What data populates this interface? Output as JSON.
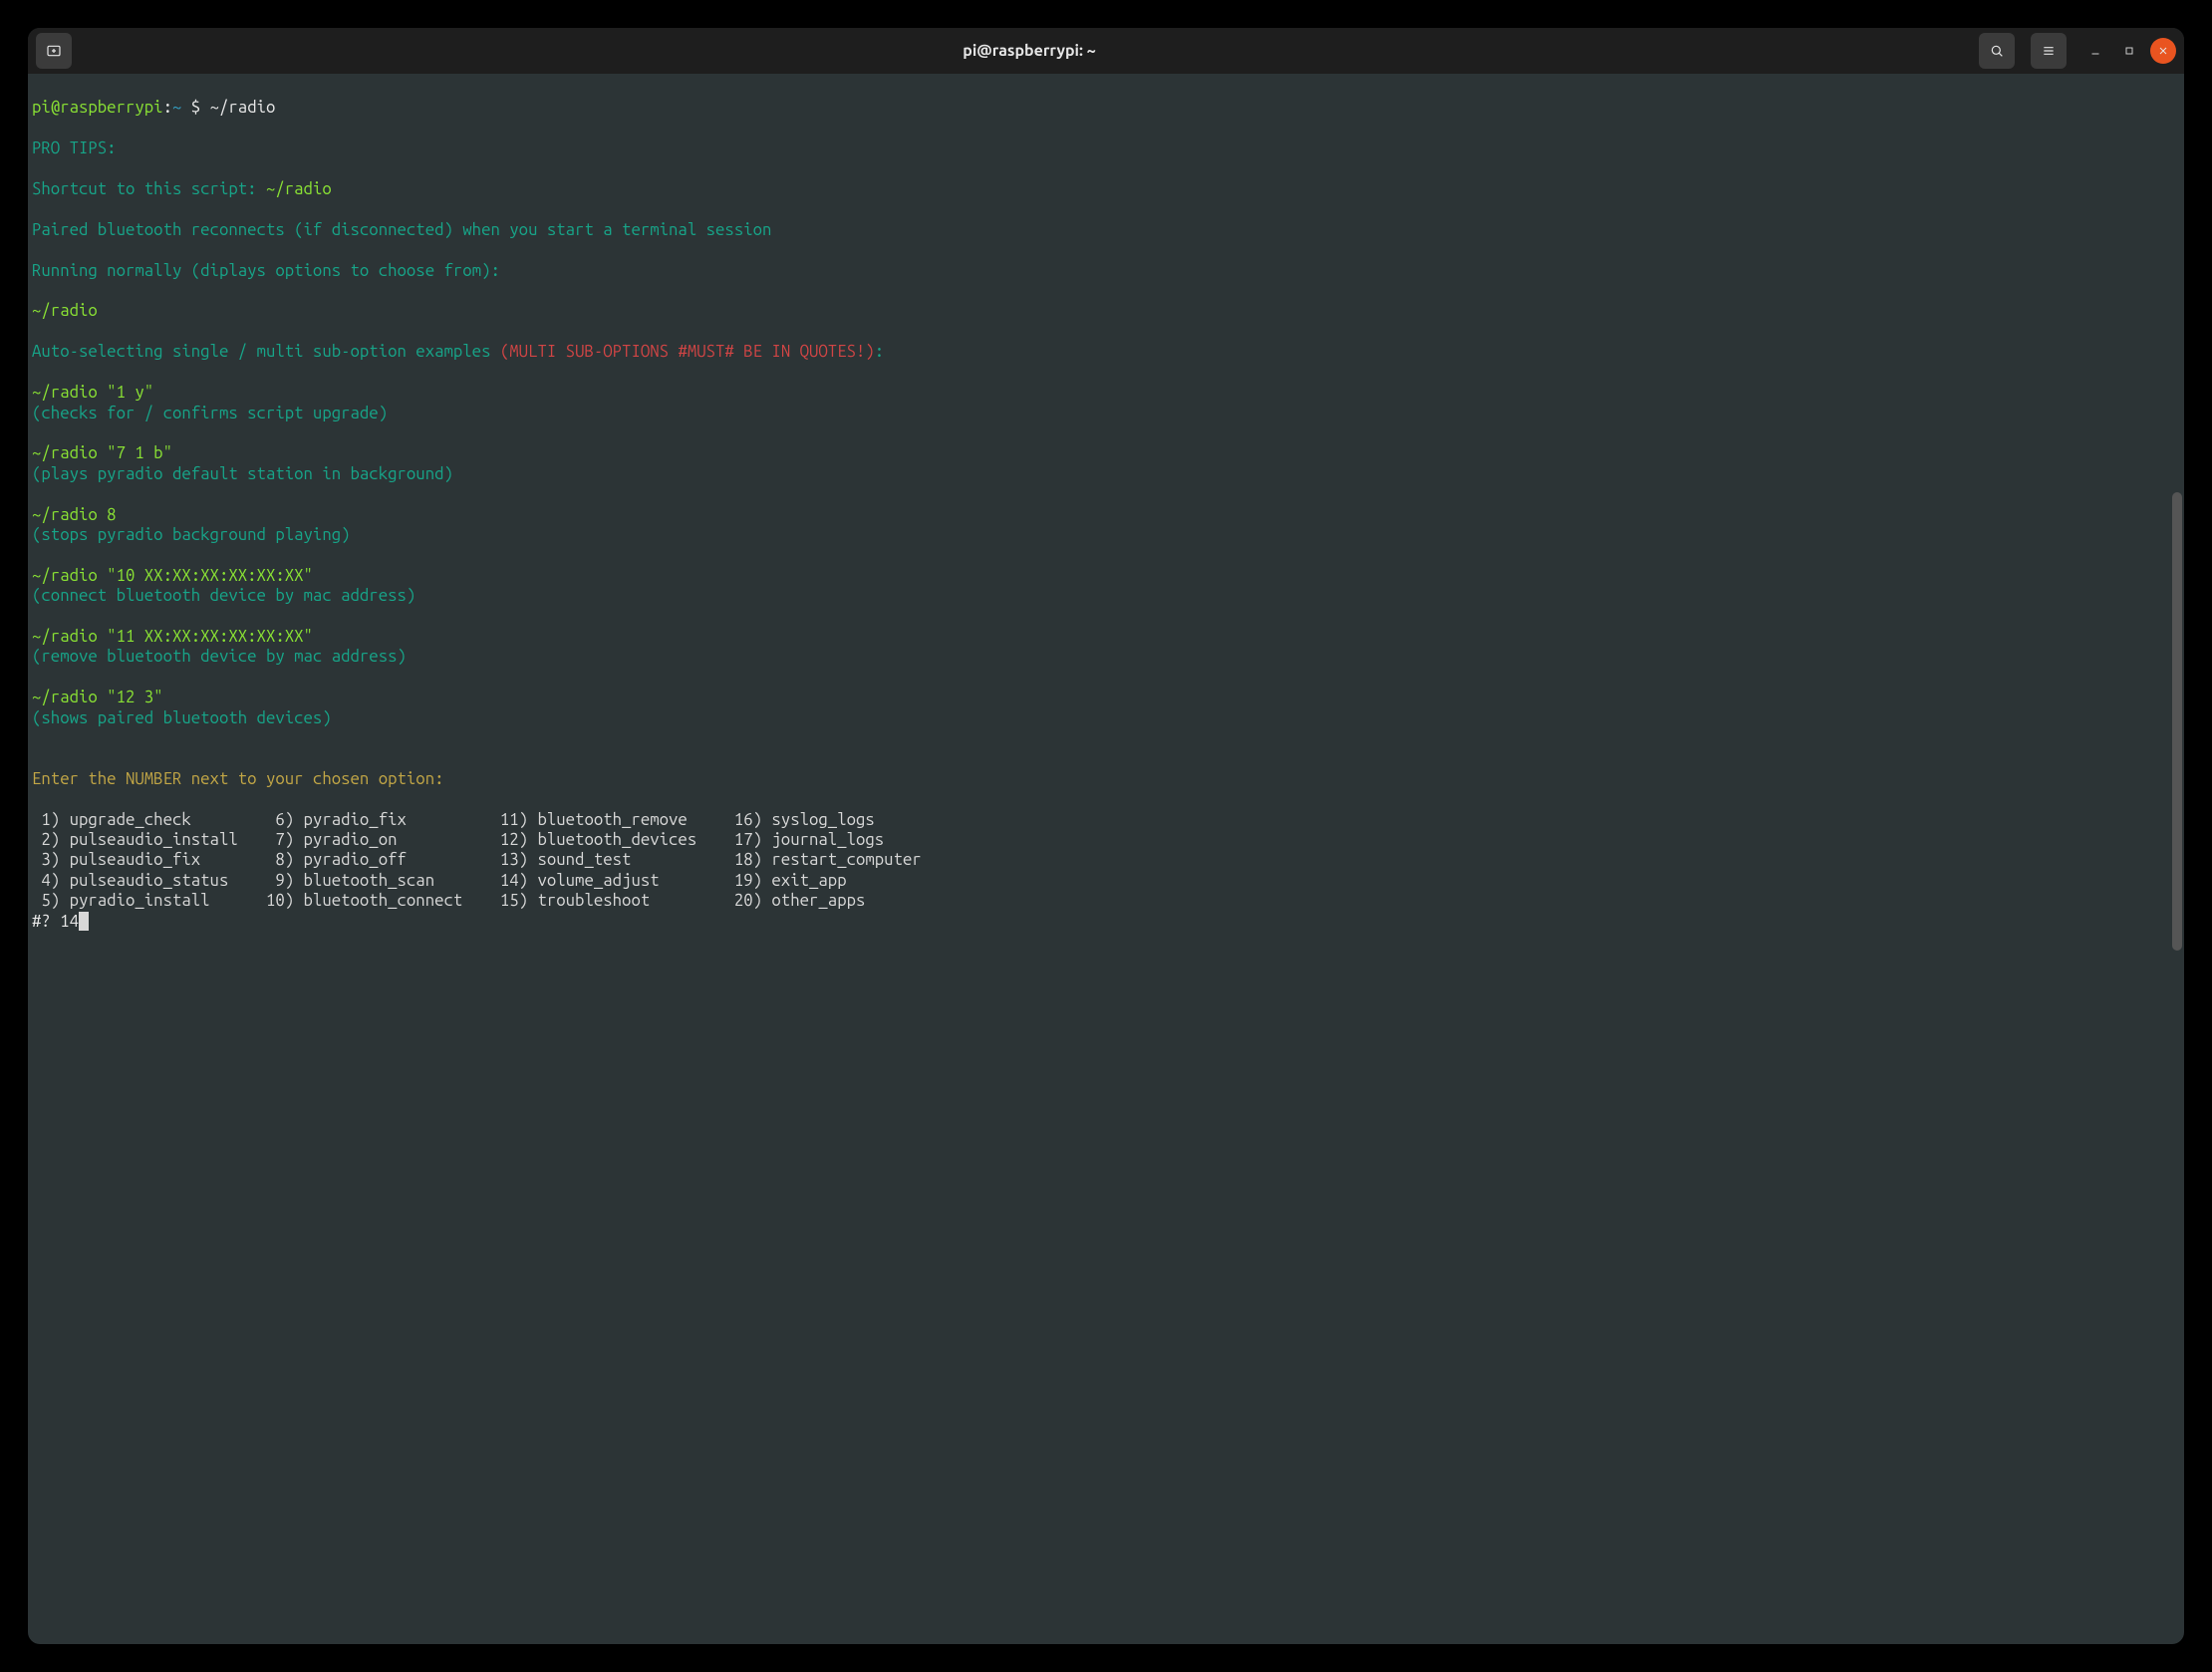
{
  "window": {
    "title": "pi@raspberrypi: ~"
  },
  "prompt": {
    "userhost": "pi@raspberrypi",
    "colon": ":",
    "path": "~",
    "dollar": "$",
    "cmd": "~/radio"
  },
  "tips": {
    "heading": "PRO TIPS:",
    "shortcut_label": "Shortcut to this script: ",
    "shortcut_cmd": "~/radio",
    "bt_reconnect": "Paired bluetooth reconnects (if disconnected) when you start a terminal session",
    "run_normal": "Running normally (diplays options to choose from):",
    "run_normal_cmd": "~/radio",
    "auto_label": "Auto-selecting single / multi sub-option examples ",
    "auto_warn": "(MULTI SUB-OPTIONS #MUST# BE IN QUOTES!)",
    "auto_colon": ":",
    "ex1_cmd": "~/radio \"1 y\"",
    "ex1_desc": "(checks for / confirms script upgrade)",
    "ex2_cmd": "~/radio \"7 1 b\"",
    "ex2_desc": "(plays pyradio default station in background)",
    "ex3_cmd": "~/radio 8",
    "ex3_desc": "(stops pyradio background playing)",
    "ex4_cmd": "~/radio \"10 XX:XX:XX:XX:XX:XX\"",
    "ex4_desc": "(connect bluetooth device by mac address)",
    "ex5_cmd": "~/radio \"11 XX:XX:XX:XX:XX:XX\"",
    "ex5_desc": "(remove bluetooth device by mac address)",
    "ex6_cmd": "~/radio \"12 3\"",
    "ex6_desc": "(shows paired bluetooth devices)"
  },
  "menu": {
    "prompt": "Enter the NUMBER next to your chosen option:",
    "items": [
      {
        "n": "1)",
        "l": "upgrade_check"
      },
      {
        "n": "2)",
        "l": "pulseaudio_install"
      },
      {
        "n": "3)",
        "l": "pulseaudio_fix"
      },
      {
        "n": "4)",
        "l": "pulseaudio_status"
      },
      {
        "n": "5)",
        "l": "pyradio_install"
      },
      {
        "n": "6)",
        "l": "pyradio_fix"
      },
      {
        "n": "7)",
        "l": "pyradio_on"
      },
      {
        "n": "8)",
        "l": "pyradio_off"
      },
      {
        "n": "9)",
        "l": "bluetooth_scan"
      },
      {
        "n": "10)",
        "l": "bluetooth_connect"
      },
      {
        "n": "11)",
        "l": "bluetooth_remove"
      },
      {
        "n": "12)",
        "l": "bluetooth_devices"
      },
      {
        "n": "13)",
        "l": "sound_test"
      },
      {
        "n": "14)",
        "l": "volume_adjust"
      },
      {
        "n": "15)",
        "l": "troubleshoot"
      },
      {
        "n": "16)",
        "l": "syslog_logs"
      },
      {
        "n": "17)",
        "l": "journal_logs"
      },
      {
        "n": "18)",
        "l": "restart_computer"
      },
      {
        "n": "19)",
        "l": "exit_app"
      },
      {
        "n": "20)",
        "l": "other_apps"
      }
    ],
    "input_prompt": "#? ",
    "input_value": "14"
  }
}
